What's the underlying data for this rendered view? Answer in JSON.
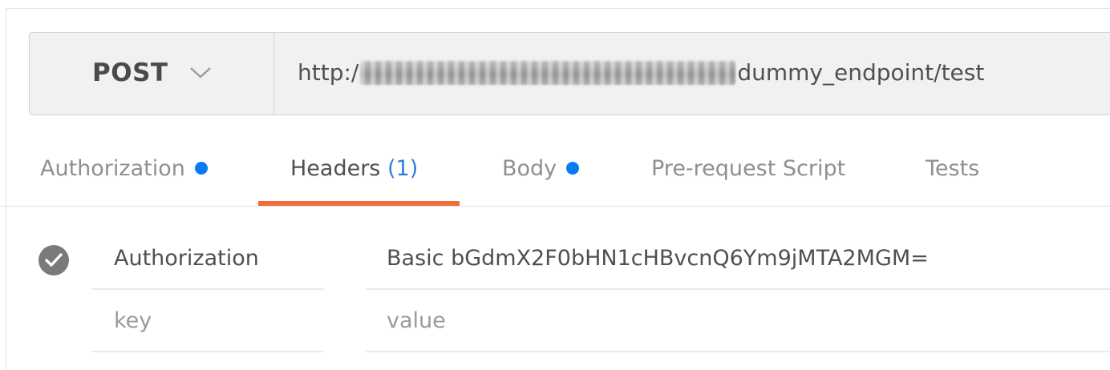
{
  "request": {
    "method": "POST",
    "url_prefix": "http:/",
    "url_suffix": "dummy_endpoint/test"
  },
  "tabs": [
    {
      "label": "Authorization",
      "has_dot": true
    },
    {
      "label": "Headers",
      "count": "(1)",
      "active": true
    },
    {
      "label": "Body",
      "has_dot": true
    },
    {
      "label": "Pre-request Script"
    },
    {
      "label": "Tests"
    }
  ],
  "headers": {
    "rows": [
      {
        "enabled": true,
        "key": "Authorization",
        "value": "Basic bGdmX2F0bHN1cHBvcnQ6Ym9jMTA2MGM="
      }
    ],
    "new_row": {
      "key_placeholder": "key",
      "value_placeholder": "value"
    }
  },
  "colors": {
    "accent": "#f26b3a",
    "dot": "#0b7af5",
    "count": "#2d7ed9",
    "check": "#7a7a7a"
  }
}
